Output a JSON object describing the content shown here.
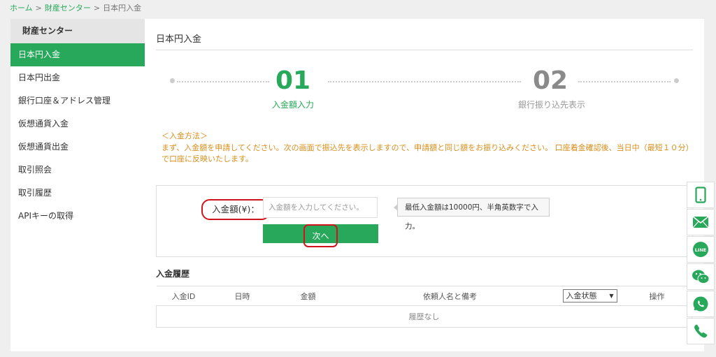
{
  "breadcrumb": {
    "home": "ホーム",
    "sep1": ">",
    "center": "財産センター",
    "sep2": ">",
    "current": "日本円入金"
  },
  "sidebar": {
    "heading": "財産センター",
    "items": [
      {
        "label": "日本円入金",
        "active": true
      },
      {
        "label": "日本円出金"
      },
      {
        "label": "銀行口座＆アドレス管理"
      },
      {
        "label": "仮想通貨入金"
      },
      {
        "label": "仮想通貨出金"
      },
      {
        "label": "取引照会"
      },
      {
        "label": "取引履歴"
      },
      {
        "label": "APIキーの取得"
      }
    ]
  },
  "main": {
    "title": "日本円入金",
    "steps": [
      {
        "num": "01",
        "label": "入金額入力",
        "active": true
      },
      {
        "num": "02",
        "label": "銀行振り込先表示",
        "active": false
      }
    ],
    "method_title": "＜入金方法＞",
    "method_text": "まず、入金額を申請してください。次の画面で振込先を表示しますので、申請額と同じ額をお振り込みください。 口座着金確認後、当日中（最短１０分）で口座に反映いたします。",
    "form": {
      "amount_label": "入金額(¥)：",
      "amount_placeholder": "入金額を入力してください。",
      "tip": "最低入金額は10000円、半角英数字で入力。",
      "next_label": "次へ"
    },
    "history": {
      "title": "入金履歴",
      "columns": [
        "入金ID",
        "日時",
        "金額",
        "依頼人名と備考",
        "入金状態",
        "操作"
      ],
      "empty_text": "履歴なし"
    }
  },
  "contact_icons": [
    "mobile-phone-icon",
    "mail-icon",
    "line-icon",
    "wechat-icon",
    "whatsapp-icon",
    "phone-icon"
  ],
  "colors": {
    "accent": "#27a85a",
    "notice": "#d88e1a",
    "highlight": "#d0121b"
  }
}
